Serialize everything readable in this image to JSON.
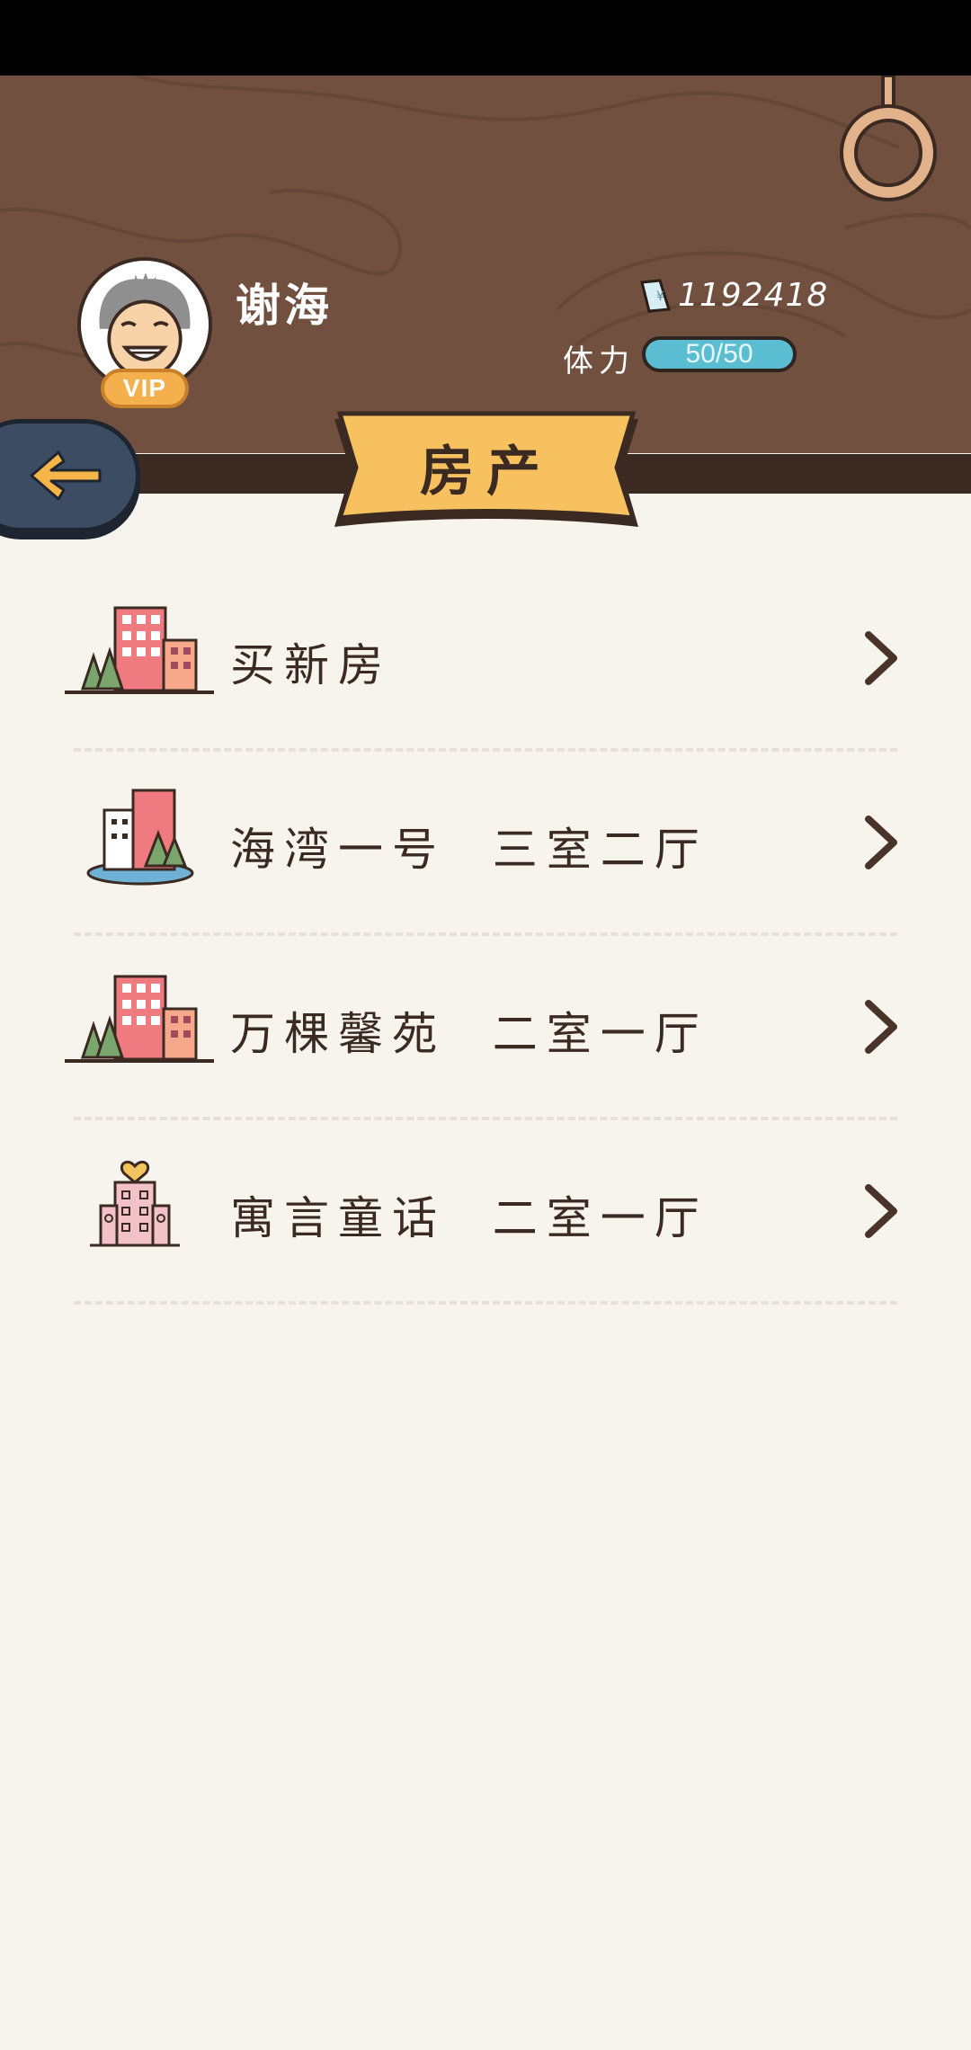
{
  "player": {
    "name": "谢海",
    "badge": "VIP",
    "money": "1192418",
    "stamina_label": "体力",
    "stamina": "50/50"
  },
  "page_title": "房产",
  "items": [
    {
      "label": "买新房",
      "icon": "city-buildings-icon"
    },
    {
      "label": "海湾一号  三室二厅",
      "icon": "lake-buildings-icon"
    },
    {
      "label": "万棵馨苑  二室一厅",
      "icon": "city-buildings-icon"
    },
    {
      "label": "寓言童话  二室一厅",
      "icon": "heart-building-icon"
    }
  ],
  "colors": {
    "wood": "#71503f",
    "banner": "#f8c15f",
    "stamina": "#5bbdd2",
    "background": "#f7f4ee"
  }
}
